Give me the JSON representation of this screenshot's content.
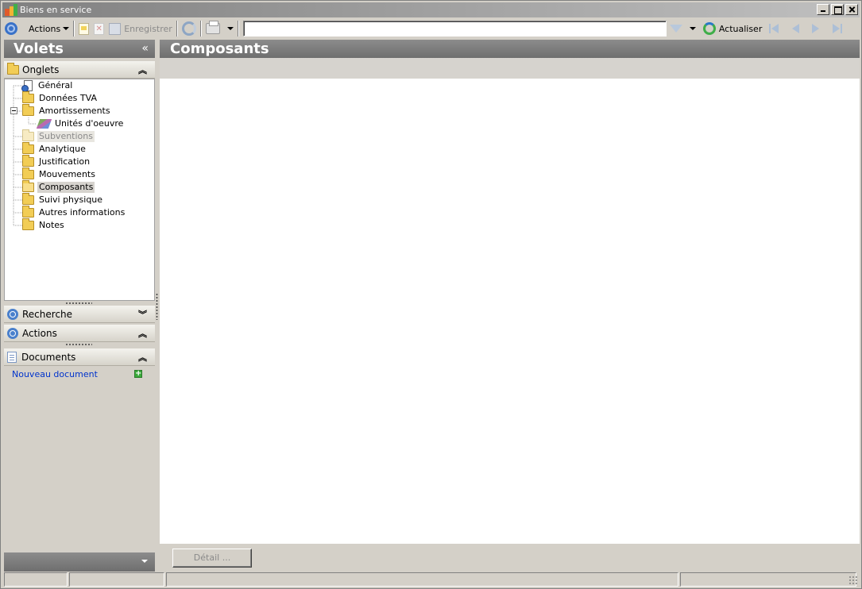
{
  "window": {
    "title": "Biens en service",
    "brand_colors": [
      "#e05a2b",
      "#f2b233",
      "#3fae49"
    ]
  },
  "toolbar": {
    "actions_label": "Actions",
    "save_label": "Enregistrer",
    "search_value": "",
    "refresh_label": "Actualiser"
  },
  "left_pane": {
    "title": "Volets",
    "collapse_glyph": "«",
    "onglets": {
      "title": "Onglets",
      "items": [
        {
          "label": "Général",
          "icon": "gear-doc-icon",
          "state": "normal"
        },
        {
          "label": "Données TVA",
          "icon": "folder-icon",
          "state": "normal"
        },
        {
          "label": "Amortissements",
          "icon": "folder-icon",
          "state": "expanded"
        },
        {
          "label": "Unités d'oeuvre",
          "icon": "units-icon",
          "state": "child"
        },
        {
          "label": "Subventions",
          "icon": "folder-icon",
          "state": "disabled"
        },
        {
          "label": "Analytique",
          "icon": "folder-icon",
          "state": "normal"
        },
        {
          "label": "Justification",
          "icon": "folder-icon",
          "state": "normal"
        },
        {
          "label": "Mouvements",
          "icon": "folder-icon",
          "state": "normal"
        },
        {
          "label": "Composants",
          "icon": "folder-open-icon",
          "state": "selected"
        },
        {
          "label": "Suivi physique",
          "icon": "folder-icon",
          "state": "normal"
        },
        {
          "label": "Autres informations",
          "icon": "folder-icon",
          "state": "normal"
        },
        {
          "label": "Notes",
          "icon": "folder-icon",
          "state": "normal"
        }
      ]
    },
    "recherche": {
      "title": "Recherche"
    },
    "actions": {
      "title": "Actions"
    },
    "documents": {
      "title": "Documents",
      "new_link": "Nouveau document"
    }
  },
  "main": {
    "title": "Composants",
    "detail_button": "Détail ..."
  }
}
